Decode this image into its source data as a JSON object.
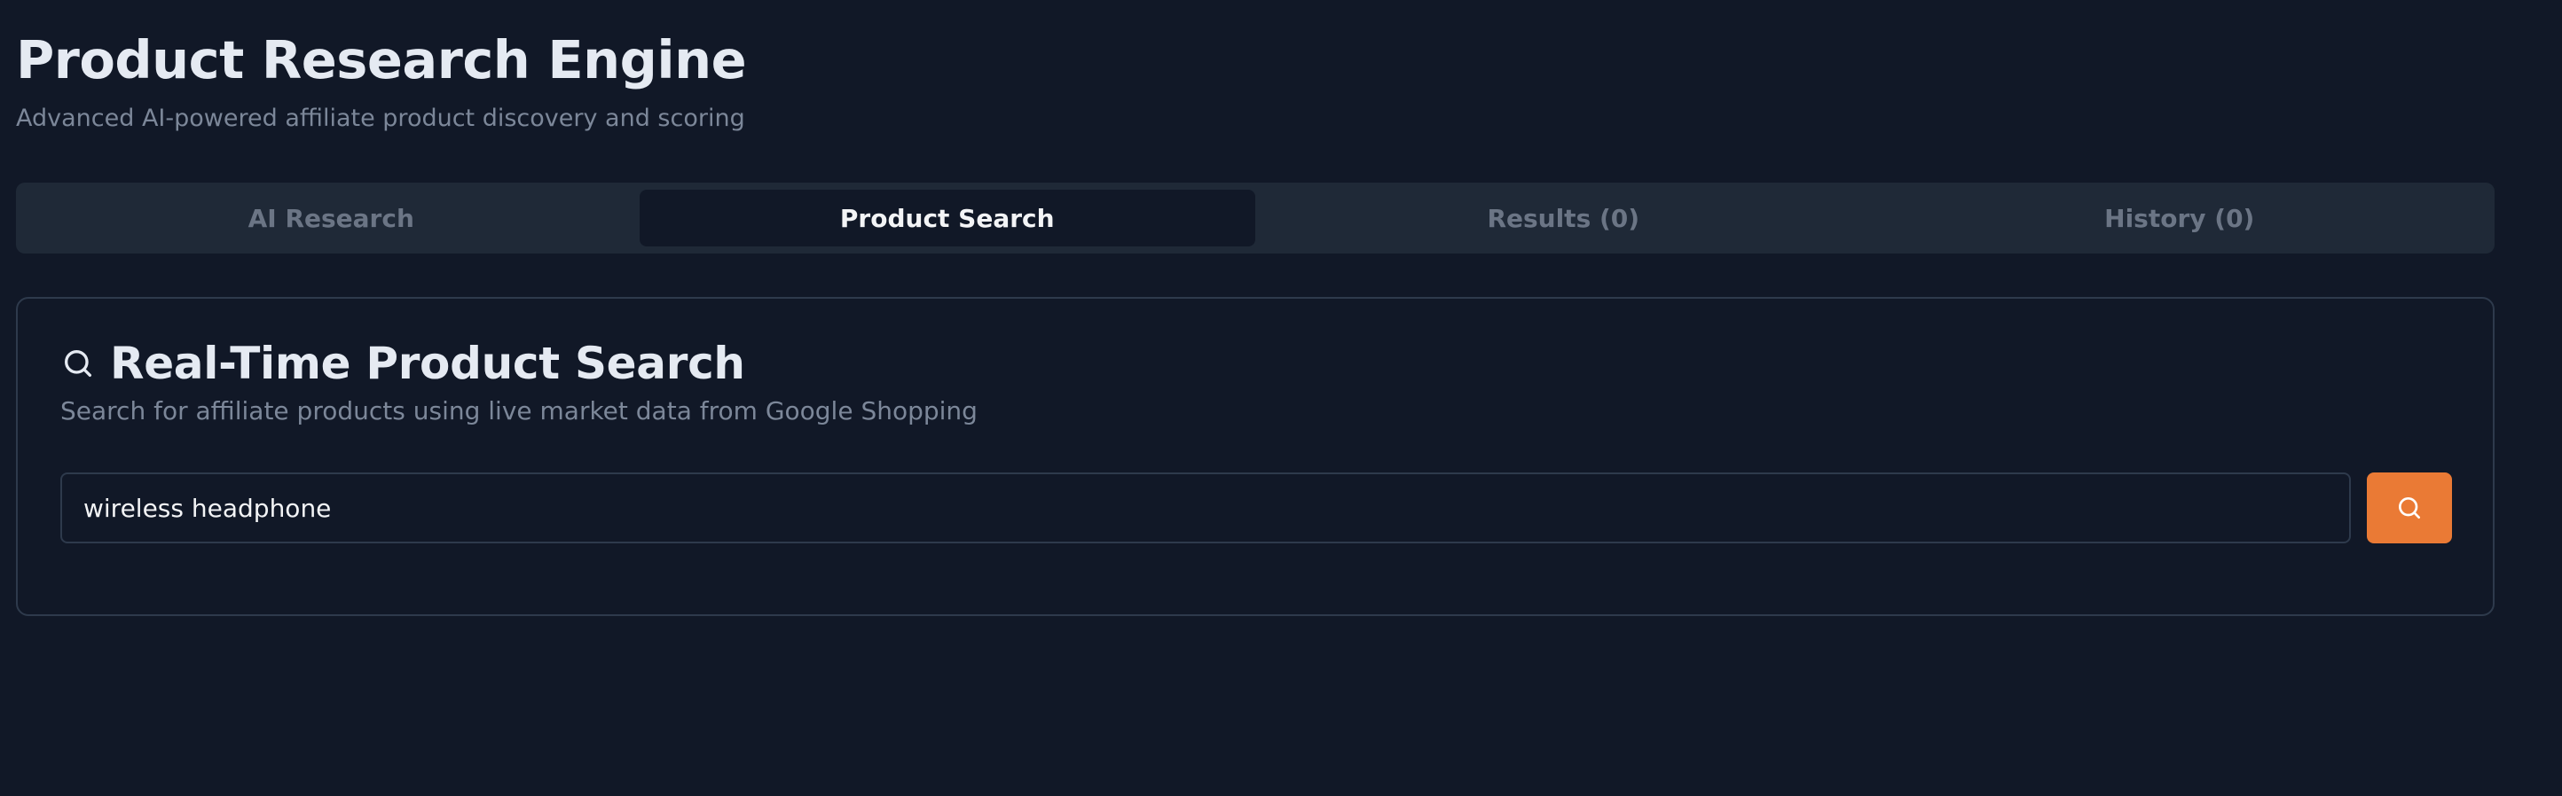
{
  "header": {
    "title": "Product Research Engine",
    "subtitle": "Advanced AI-powered affiliate product discovery and scoring"
  },
  "tabs": [
    {
      "label": "AI Research",
      "active": false
    },
    {
      "label": "Product Search",
      "active": true
    },
    {
      "label": "Results (0)",
      "active": false
    },
    {
      "label": "History (0)",
      "active": false
    }
  ],
  "search_card": {
    "icon": "search-icon",
    "title": "Real-Time Product Search",
    "description": "Search for affiliate products using live market data from Google Shopping",
    "input_value": "wireless headphone",
    "button_icon": "search-icon"
  },
  "colors": {
    "background": "#111827",
    "tab_bar": "#1f2937",
    "accent": "#ea7a35",
    "muted_text": "#7c8799"
  }
}
